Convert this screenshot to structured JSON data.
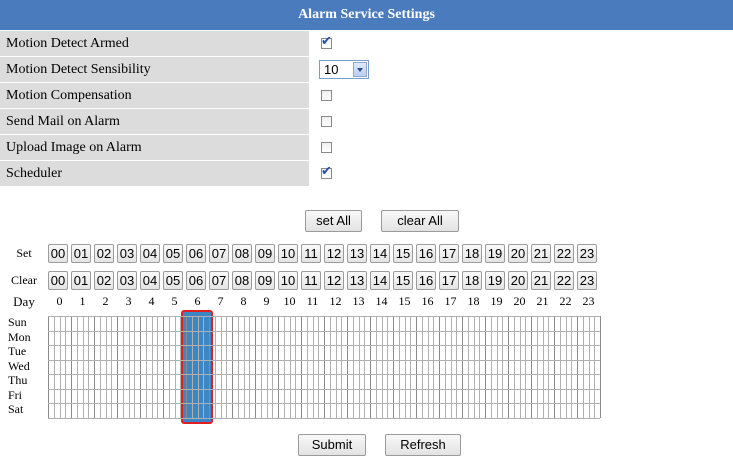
{
  "header": {
    "title": "Alarm Service Settings"
  },
  "settings": [
    {
      "label": "Motion Detect Armed",
      "type": "checkbox",
      "checked": true
    },
    {
      "label": "Motion Detect Sensibility",
      "type": "select",
      "value": "10"
    },
    {
      "label": "Motion Compensation",
      "type": "checkbox",
      "checked": false
    },
    {
      "label": "Send Mail on Alarm",
      "type": "checkbox",
      "checked": false
    },
    {
      "label": "Upload Image on Alarm",
      "type": "checkbox",
      "checked": false
    },
    {
      "label": "Scheduler",
      "type": "checkbox",
      "checked": true
    }
  ],
  "buttons": {
    "set_all": "set All",
    "clear_all": "clear All",
    "submit": "Submit",
    "refresh": "Refresh"
  },
  "schedule": {
    "set_label": "Set",
    "clear_label": "Clear",
    "day_label": "Day",
    "hour_buttons": [
      "00",
      "01",
      "02",
      "03",
      "04",
      "05",
      "06",
      "07",
      "08",
      "09",
      "10",
      "11",
      "12",
      "13",
      "14",
      "15",
      "16",
      "17",
      "18",
      "19",
      "20",
      "21",
      "22",
      "23"
    ],
    "hour_numbers": [
      "0",
      "1",
      "2",
      "3",
      "4",
      "5",
      "6",
      "7",
      "8",
      "9",
      "10",
      "11",
      "12",
      "13",
      "14",
      "15",
      "16",
      "17",
      "18",
      "19",
      "20",
      "21",
      "22",
      "23"
    ],
    "days": [
      "Sun",
      "Mon",
      "Tue",
      "Wed",
      "Thu",
      "Fri",
      "Sat"
    ],
    "selected_hour": 6
  }
}
